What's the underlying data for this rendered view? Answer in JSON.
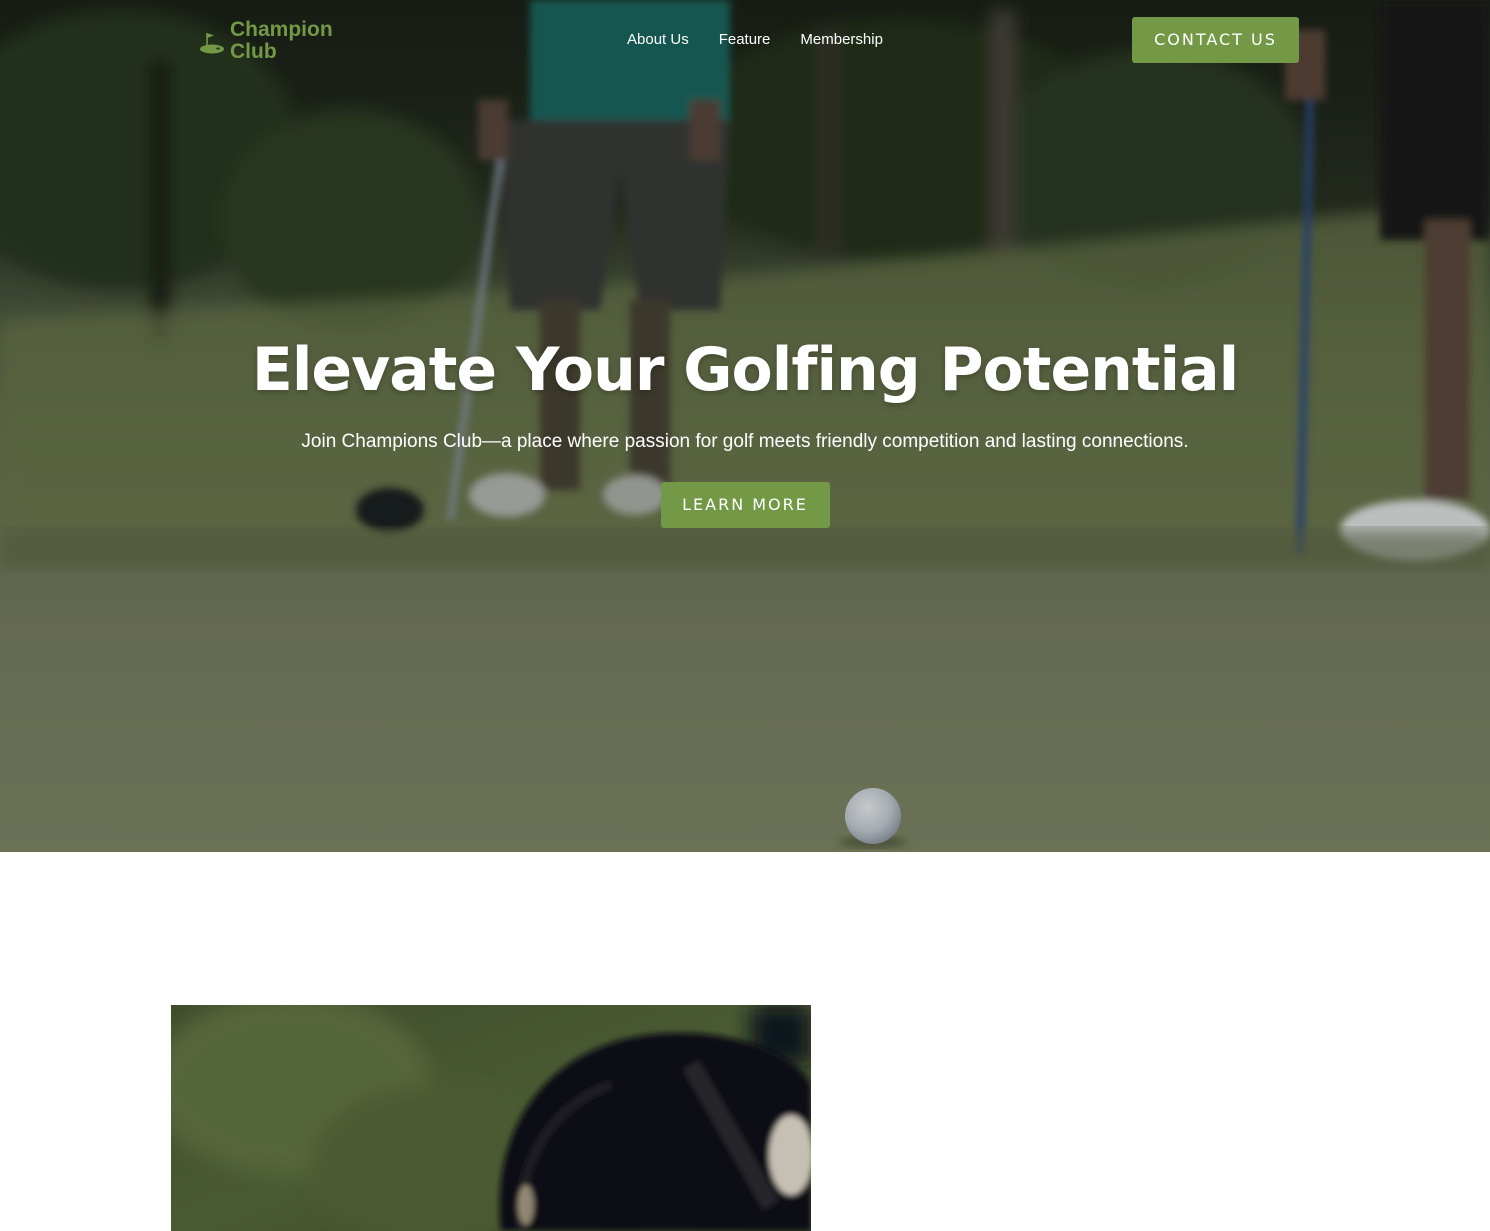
{
  "brand": {
    "name_line1": "Champion",
    "name_line2": "Club",
    "icon": "golf-flag-icon",
    "color": "#739846"
  },
  "nav": {
    "links": [
      "About Us",
      "Feature",
      "Membership"
    ],
    "contact_label": "CONTACT US"
  },
  "hero": {
    "title": "Elevate Your Golfing Potential",
    "subtitle": "Join Champions Club—a place where passion for golf meets friendly competition and lasting connections.",
    "cta_label": "LEARN MORE",
    "background": "photo-golfers-putting-green-with-ball"
  },
  "feature_section": {
    "image": "photo-golf-bag-closeup-on-grass"
  },
  "colors": {
    "accent": "#739846",
    "hero_text": "#ffffff",
    "page_bg": "#ffffff"
  }
}
